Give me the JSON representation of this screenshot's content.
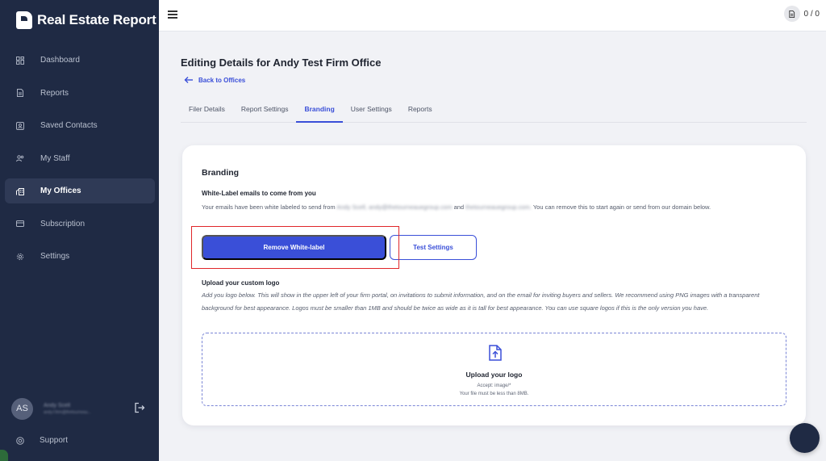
{
  "brand": {
    "name": "Real Estate Report"
  },
  "sidebar": {
    "items": [
      {
        "label": "Dashboard",
        "icon": "dashboard-icon"
      },
      {
        "label": "Reports",
        "icon": "document-icon"
      },
      {
        "label": "Saved Contacts",
        "icon": "contacts-icon"
      },
      {
        "label": "My Staff",
        "icon": "staff-icon"
      },
      {
        "label": "My Offices",
        "icon": "offices-icon",
        "active": true
      },
      {
        "label": "Subscription",
        "icon": "card-icon"
      },
      {
        "label": "Settings",
        "icon": "gear-icon"
      }
    ],
    "user": {
      "initials": "AS",
      "name": "Andy Scell",
      "email": "andy.f.firm@thetourneau..."
    },
    "support_label": "Support"
  },
  "topbar": {
    "credits": "0 / 0"
  },
  "main": {
    "title": "Editing Details for Andy Test Firm Office",
    "back_label": "Back to Offices",
    "tabs": [
      {
        "label": "Filer Details"
      },
      {
        "label": "Report Settings"
      },
      {
        "label": "Branding",
        "active": true
      },
      {
        "label": "User Settings"
      },
      {
        "label": "Reports"
      }
    ]
  },
  "branding": {
    "title": "Branding",
    "wl_label": "White-Label emails to come from you",
    "wl_desc_prefix": "Your emails have been white labeled to send from",
    "wl_sender": "Andy Scell, andy@thetourneauegroup.com",
    "wl_and": "and",
    "wl_domain": "thetourneauegroup.com.",
    "wl_desc_suffix": "You can remove this to start again or send from our domain below.",
    "remove_button": "Remove White-label",
    "test_button": "Test Settings",
    "upload_title": "Upload your custom logo",
    "upload_desc": "Add you logo below. This will show in the upper left of your firm portal, on invitations to submit information, and on the email for inviting buyers and sellers. We recommend using PNG images with a transparent background for best appearance. Logos must be smaller than 1MB and should be twice as wide as it is tall for best appearance. You can use square logos if this is the only version you have.",
    "dropzone_title": "Upload your logo",
    "dropzone_accept": "Accept: image/*",
    "dropzone_size": "Your file must be less than 8MB."
  },
  "colors": {
    "accent": "#3a4fd8",
    "sidebar": "#1f2a44",
    "highlight": "#e0262a"
  }
}
